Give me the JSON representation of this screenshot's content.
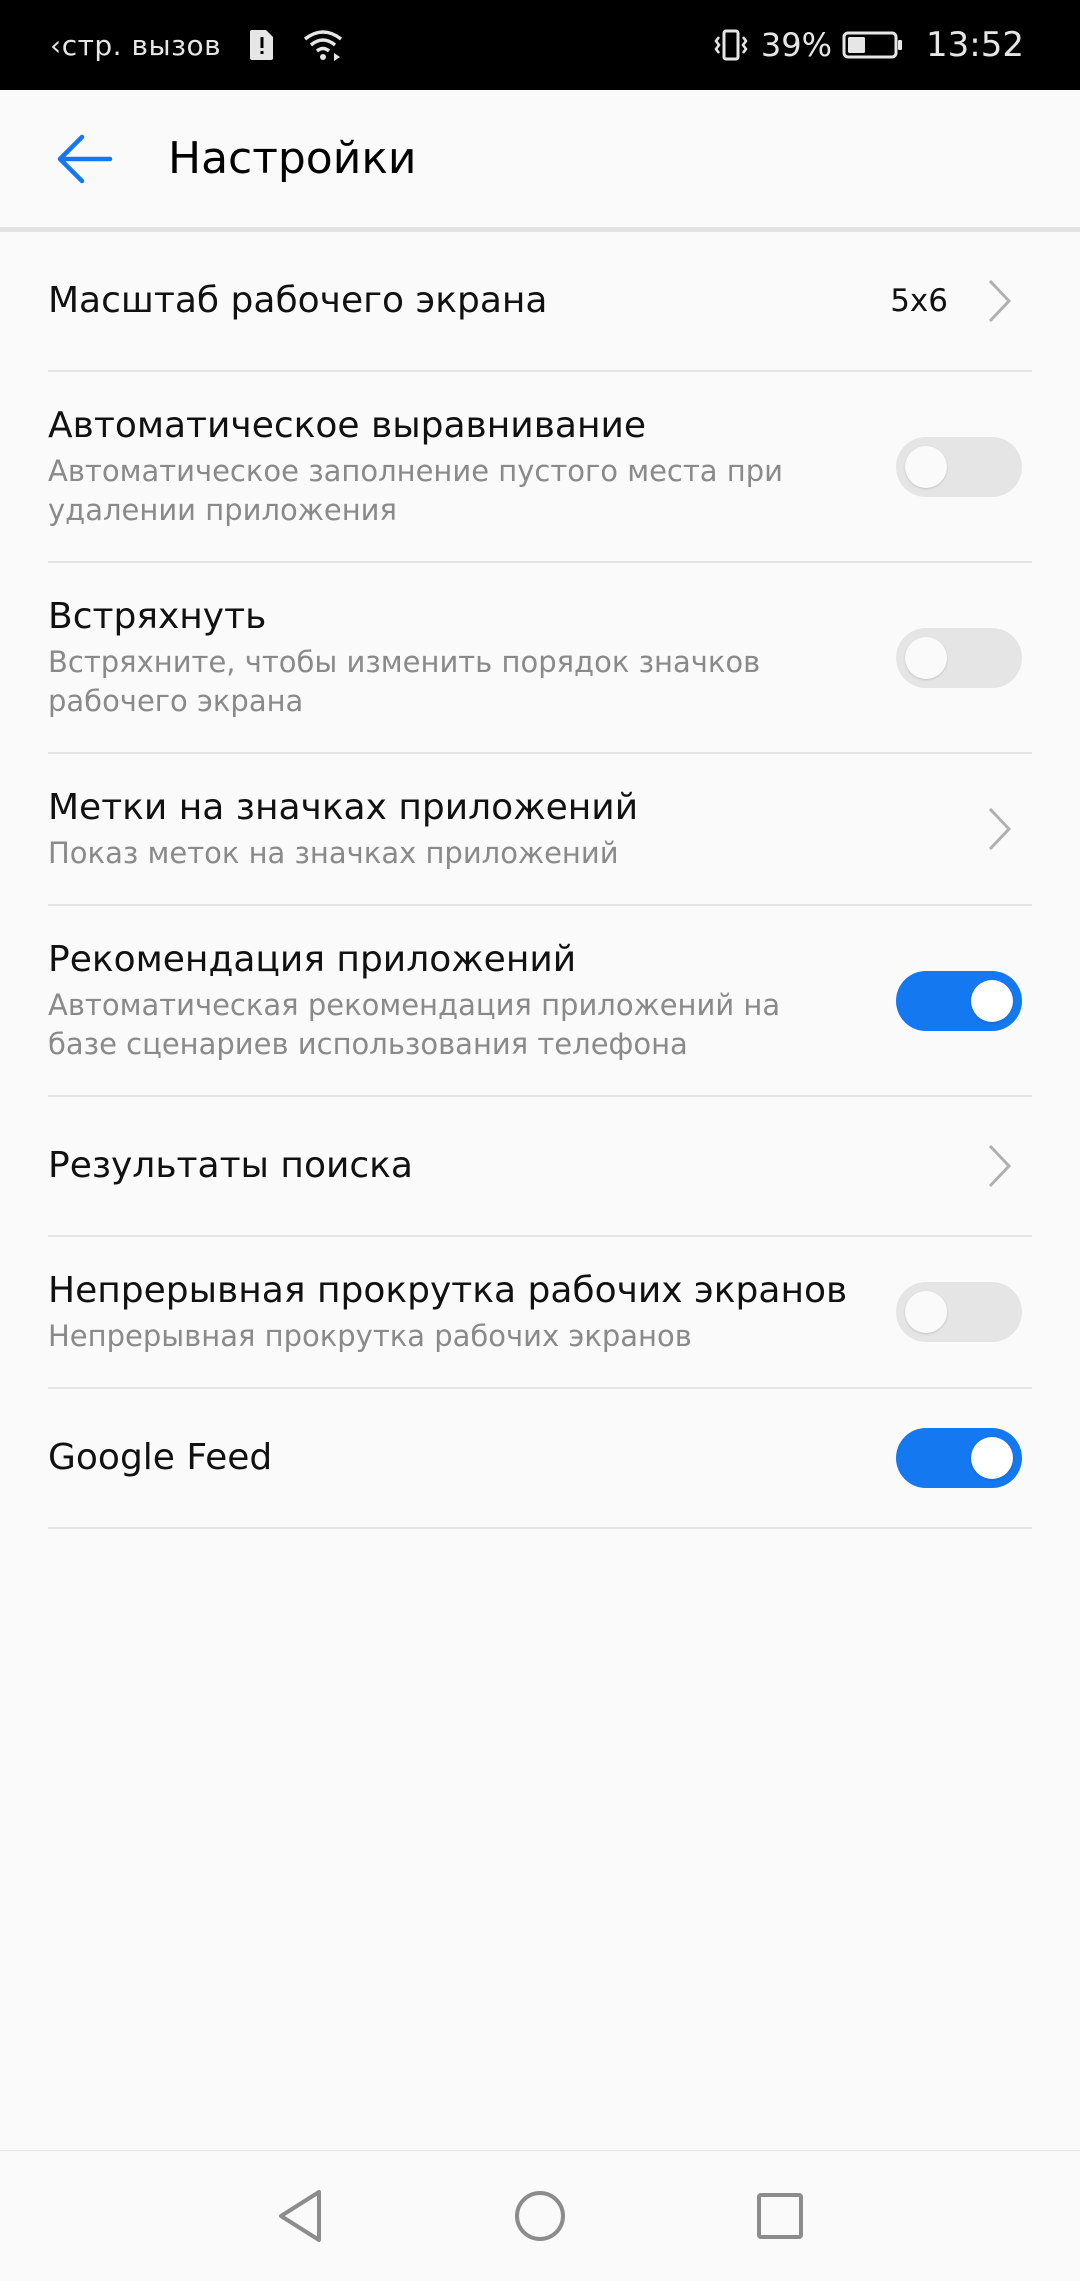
{
  "status_bar": {
    "carrier": "‹стр. вызов",
    "battery_percent": "39%",
    "time": "13:52",
    "battery_level": 0.39,
    "icons": [
      "sim-alert-icon",
      "wifi-icon",
      "vibrate-icon",
      "battery-icon"
    ]
  },
  "app_bar": {
    "title": "Настройки",
    "back_icon": "arrow-left-icon"
  },
  "colors": {
    "accent": "#1478f0",
    "toggle_off": "#e5e5e5",
    "subtitle": "#8a8a8a",
    "divider": "#e4e4e4"
  },
  "settings": [
    {
      "title": "Масштаб рабочего экрана",
      "value": "5x6",
      "control": "chevron"
    },
    {
      "title": "Автоматическое выравнивание",
      "subtitle_line1": "Автоматическое заполнение пустого места при",
      "subtitle_line2": "удалении приложения",
      "control": "toggle",
      "on": false
    },
    {
      "title": "Встряхнуть",
      "subtitle_line1": "Встряхните, чтобы изменить порядок значков",
      "subtitle_line2": "рабочего экрана",
      "control": "toggle",
      "on": false
    },
    {
      "title": "Метки на значках приложений",
      "subtitle_line1": "Показ меток на значках приложений",
      "control": "chevron"
    },
    {
      "title": "Рекомендация приложений",
      "subtitle_line1": "Автоматическая рекомендация приложений на",
      "subtitle_line2": "базе сценариев использования телефона",
      "control": "toggle",
      "on": true
    },
    {
      "title": "Результаты поиска",
      "control": "chevron"
    },
    {
      "title": "Непрерывная прокрутка рабочих экранов",
      "subtitle_line1": "Непрерывная прокрутка рабочих экранов",
      "control": "toggle",
      "on": false
    },
    {
      "title": "Google Feed",
      "control": "toggle",
      "on": true
    }
  ],
  "nav_bar": {
    "icons": [
      "back-triangle-icon",
      "home-circle-icon",
      "recents-square-icon"
    ]
  }
}
